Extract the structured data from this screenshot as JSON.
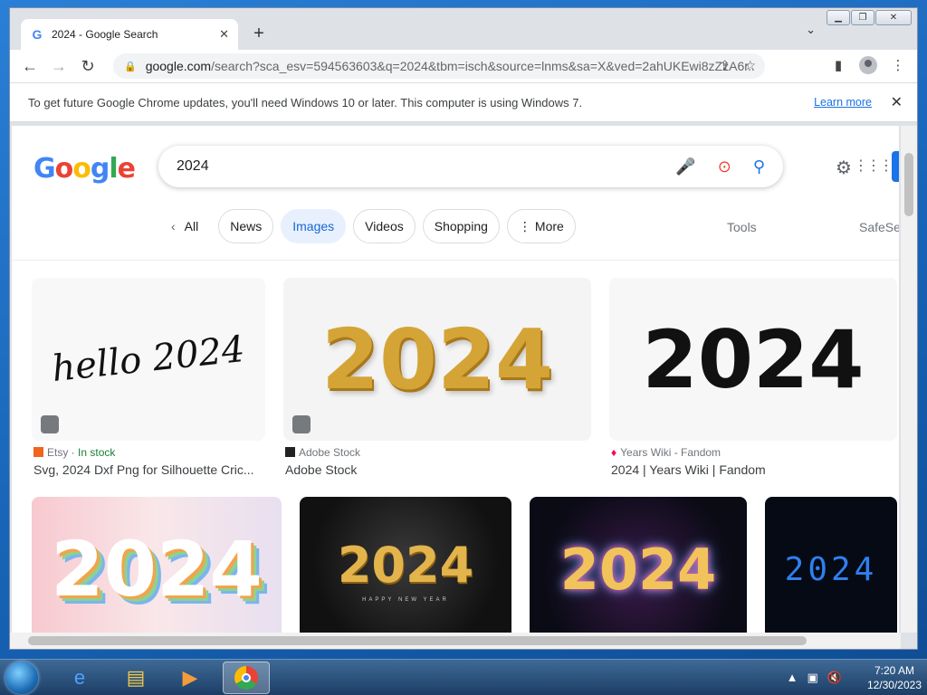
{
  "browser": {
    "tab_title": "2024 - Google Search",
    "tab_favicon": "G",
    "new_tab_label": "+",
    "url_host": "google.com",
    "url_path": "/search?sca_esv=594563603&q=2024&tbm=isch&source=lnms&sa=X&ved=2ahUKEwi8zZzA6r...",
    "infobar_text": "To get future Google Chrome updates, you'll need Windows 10 or later. This computer is using Windows 7.",
    "infobar_learn_more": "Learn more"
  },
  "google": {
    "logo_letters": [
      "G",
      "o",
      "o",
      "g",
      "l",
      "e"
    ],
    "query": "2024",
    "chips": {
      "all": "All",
      "news": "News",
      "images": "Images",
      "videos": "Videos",
      "shopping": "Shopping",
      "more": "More"
    },
    "tools": "Tools",
    "safesearch": "SafeSe"
  },
  "results": {
    "row1": [
      {
        "source": "Etsy",
        "stock": "In stock",
        "caption": "Svg, 2024 Dxf Png for Silhouette Cric...",
        "thumb_text": "hello 2024"
      },
      {
        "source": "Adobe Stock",
        "caption": "Adobe Stock",
        "thumb_text": "2024"
      },
      {
        "source": "Years Wiki - Fandom",
        "caption": "2024 | Years Wiki | Fandom",
        "thumb_text": "2024"
      }
    ],
    "row2": [
      {
        "thumb_text": "2024"
      },
      {
        "thumb_text": "2024",
        "subtext": "HAPPY NEW YEAR"
      },
      {
        "thumb_text": "2024"
      },
      {
        "thumb_text": "2024"
      }
    ]
  },
  "taskbar": {
    "time": "7:20 AM",
    "date": "12/30/2023"
  },
  "colors": {
    "accent": "#1a73e8",
    "chip_active_bg": "#e8f0fe",
    "gold": "#d4a437"
  }
}
